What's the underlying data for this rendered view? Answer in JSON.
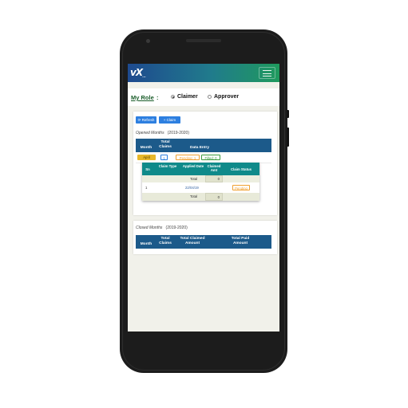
{
  "app": {
    "logo_text": "vX",
    "logo_sub": "...",
    "menu_icon": "hamburger-menu-icon"
  },
  "role": {
    "title": "My Role",
    "colon": ":",
    "options": [
      {
        "label": "Claimer",
        "selected": true
      },
      {
        "label": "Approver",
        "selected": false
      }
    ]
  },
  "toolbar": {
    "refresh_label": "Refresh",
    "refresh_icon": "refresh-icon",
    "claim_label": "+ Claim"
  },
  "opened": {
    "title": "Opened Months",
    "period": "(2019-2020)",
    "headers": {
      "month": "Month",
      "total_claims": "Total Claims",
      "data_entry": "Data Entry"
    },
    "row": {
      "month": "April",
      "total_claims": "1",
      "pending": "Pending: 1",
      "filled": "Filled: 0"
    },
    "detail": {
      "headers": {
        "sn": "Sn",
        "claim_type": "Claim Type",
        "applied_date": "Applied Date",
        "claimed_amt": "Claimed Amt",
        "claim_status": "Claim Status"
      },
      "top_total_label": "Total",
      "top_total_value": "0",
      "rows": [
        {
          "sn": "1",
          "claim_type": "",
          "applied_date": "22/04/19",
          "claimed_amt": "",
          "claim_status": "Pending"
        }
      ],
      "bottom_total_label": "Total",
      "bottom_total_value": "0"
    }
  },
  "closed": {
    "title": "Closed Months",
    "period": "(2019-2020)",
    "headers": {
      "month": "Month",
      "total_claims": "Total Claims",
      "total_claimed_amount": "Total Claimed Amount",
      "total_paid_amount": "Total Paid Amount"
    }
  },
  "colors": {
    "header_blue": "#1c5a8a",
    "detail_teal": "#0f8a8a",
    "button_blue": "#2d7fe0",
    "pending_orange": "#f0a030",
    "filled_green": "#3c9a3c",
    "month_yellow": "#e8b72a"
  }
}
